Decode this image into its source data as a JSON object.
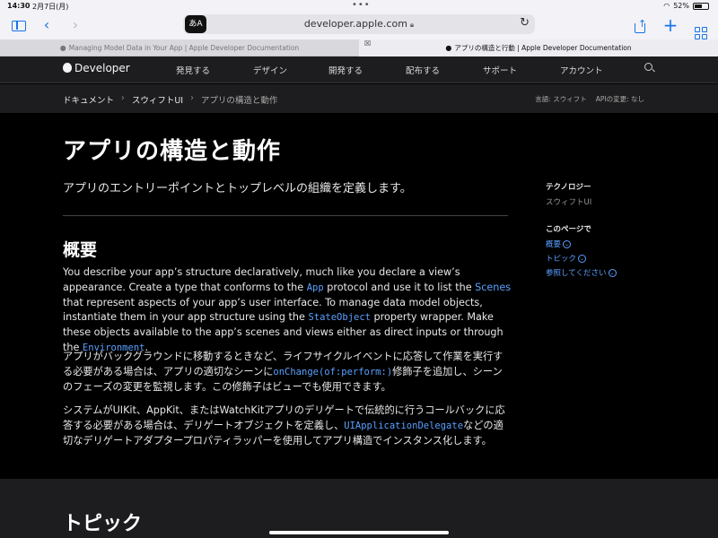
{
  "status": {
    "time": "14:30",
    "date": "2月7日(月)",
    "battery": "52%"
  },
  "browser": {
    "url": "developer.apple.com",
    "translate_label": "あA",
    "tabs": [
      {
        "title": "Managing Model Data in Your App | Apple Developer Documentation"
      },
      {
        "title": "アプリの構造と行動 | Apple Developer Documentation"
      }
    ]
  },
  "nav": {
    "brand": "Developer",
    "items": [
      "発見する",
      "デザイン",
      "開発する",
      "配布する",
      "サポート",
      "アカウント"
    ]
  },
  "breadcrumb": {
    "items": [
      "ドキュメント",
      "スウィフトUI",
      "アプリの構造と動作"
    ],
    "language": "言語: スウィフト",
    "api_changes": "APIの変更: なし"
  },
  "main": {
    "title": "アプリの構造と動作",
    "abstract": "アプリのエントリーポイントとトップレベルの組織を定義します。",
    "overview_heading": "概要",
    "p1": {
      "t1": "You describe your app’s structure declaratively, much like you declare a view’s appearance. Create a type that conforms to the ",
      "c1": "App",
      "t2": " protocol and use it to list the ",
      "l1": "Scenes",
      "t3": " that represent aspects of your app’s user interface. To manage data model objects, instantiate them in your app structure using the ",
      "c2": "StateObject",
      "t4": " property wrapper. Make these objects available to the app’s scenes and views either as direct inputs or through the ",
      "c3": "Environment",
      "t5": "."
    },
    "p2": {
      "t1": "アプリがバックグラウンドに移動するときなど、ライフサイクルイベントに応答して作業を実行する必要がある場合は、アプリの適切なシーンに",
      "c1": "onChange(of:perform:)",
      "t2": "修飾子を追加し、シーンのフェーズの変更を監視します。この修飾子はビューでも使用できます。"
    },
    "p3": {
      "t1": "システムがUIKit、AppKit、またはWatchKitアプリのデリゲートで伝統的に行うコールバックに応答する必要がある場合は、デリゲートオブジェクトを定義し、",
      "c1": "UIApplicationDelegate",
      "t2": "などの適切なデリゲートアダプタープロパティラッパーを使用してアプリ構造でインスタンス化します。"
    },
    "topics_heading": "トピック"
  },
  "sidebar": {
    "tech_heading": "テクノロジー",
    "tech_value": "スウィフトUI",
    "onpage_heading": "このページで",
    "links": [
      "概要",
      "トピック",
      "参照してください"
    ]
  }
}
